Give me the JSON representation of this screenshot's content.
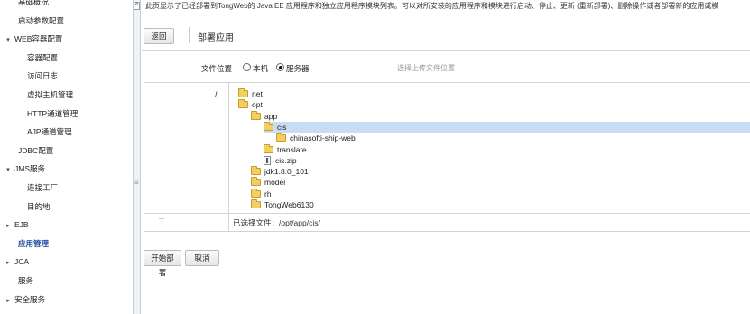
{
  "sidebar": {
    "items": [
      {
        "label": "基础概况",
        "level": 0,
        "arrow": "none"
      },
      {
        "label": "启动参数配置",
        "level": 0,
        "arrow": "none"
      },
      {
        "label": "WEB容器配置",
        "level": 0,
        "arrow": "down"
      },
      {
        "label": "容器配置",
        "level": 1,
        "arrow": "none"
      },
      {
        "label": "访问日志",
        "level": 1,
        "arrow": "none"
      },
      {
        "label": "虚拟主机管理",
        "level": 1,
        "arrow": "none"
      },
      {
        "label": "HTTP通道管理",
        "level": 1,
        "arrow": "none"
      },
      {
        "label": "AJP通道管理",
        "level": 1,
        "arrow": "none"
      },
      {
        "label": "JDBC配置",
        "level": 0,
        "arrow": "none"
      },
      {
        "label": "JMS服务",
        "level": 0,
        "arrow": "down"
      },
      {
        "label": "连接工厂",
        "level": 1,
        "arrow": "none"
      },
      {
        "label": "目的地",
        "level": 1,
        "arrow": "none"
      },
      {
        "label": "EJB",
        "level": 0,
        "arrow": "right"
      },
      {
        "label": "应用管理",
        "level": 0,
        "arrow": "none",
        "active": true
      },
      {
        "label": "JCA",
        "level": 0,
        "arrow": "right"
      },
      {
        "label": "服务",
        "level": 0,
        "arrow": "none"
      },
      {
        "label": "安全服务",
        "level": 0,
        "arrow": "right"
      }
    ]
  },
  "main": {
    "description": "此页显示了已经部署到TongWeb的 Java EE 应用程序和独立应用程序模块列表。可以对所安装的应用程序和模块进行启动、停止、更新 (重新部署)、删除操作或者部署新的应用或模",
    "back_label": "返回",
    "page_title": "部署应用",
    "file_location_label": "文件位置",
    "radio_local": "本机",
    "radio_server": "服务器",
    "radio_selected": "服务器",
    "upload_hint": "选择上传文件位置",
    "tree_root": "/",
    "tree": [
      {
        "name": "net",
        "depth": 0,
        "type": "folder"
      },
      {
        "name": "opt",
        "depth": 0,
        "type": "folder"
      },
      {
        "name": "app",
        "depth": 1,
        "type": "folder"
      },
      {
        "name": "cis",
        "depth": 2,
        "type": "folder",
        "selected": true
      },
      {
        "name": "chinasofti-ship-web",
        "depth": 3,
        "type": "folder"
      },
      {
        "name": "translate",
        "depth": 2,
        "type": "folder"
      },
      {
        "name": "cis.zip",
        "depth": 2,
        "type": "file"
      },
      {
        "name": "jdk1.8.0_101",
        "depth": 1,
        "type": "folder"
      },
      {
        "name": "model",
        "depth": 1,
        "type": "folder"
      },
      {
        "name": "rh",
        "depth": 1,
        "type": "folder"
      },
      {
        "name": "TongWeb6130",
        "depth": 1,
        "type": "folder"
      }
    ],
    "selected_file_text": "已选择文件：/opt/app/cis/",
    "start_deploy_label": "开始部署",
    "cancel_label": "取消"
  },
  "colors": {
    "selected_row": "#c9dcf6",
    "active_nav": "#1a4ca0",
    "folder": "#f2cf61"
  }
}
